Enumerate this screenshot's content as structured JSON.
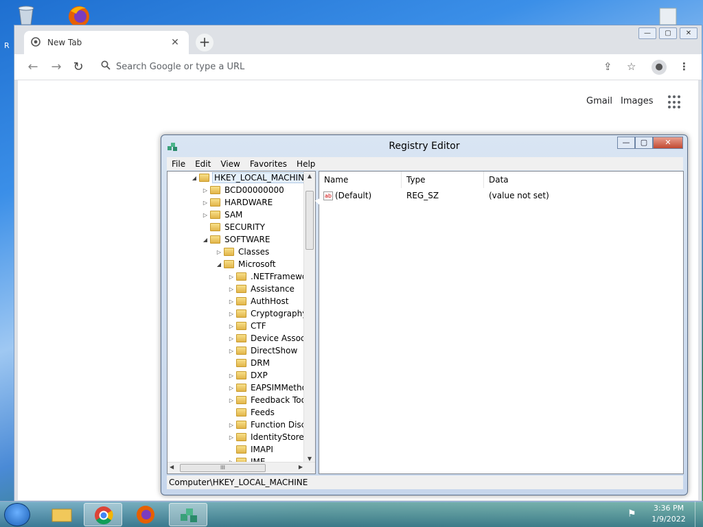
{
  "desktop": {
    "recycle_partial_label": "R"
  },
  "chrome": {
    "tab_title": "New Tab",
    "tab_close": "✕",
    "new_tab": "+",
    "omnibox_placeholder": "Search Google or type a URL",
    "links": {
      "gmail": "Gmail",
      "images": "Images"
    }
  },
  "registry": {
    "title": "Registry Editor",
    "menu": [
      "File",
      "Edit",
      "View",
      "Favorites",
      "Help"
    ],
    "tree": [
      {
        "label": "HKEY_LOCAL_MACHINE",
        "arrow": "◢",
        "selected": true,
        "level": 0
      },
      {
        "label": "BCD00000000",
        "arrow": "▷",
        "level": 1
      },
      {
        "label": "HARDWARE",
        "arrow": "▷",
        "level": 1
      },
      {
        "label": "SAM",
        "arrow": "▷",
        "level": 1
      },
      {
        "label": "SECURITY",
        "arrow": "",
        "level": 1
      },
      {
        "label": "SOFTWARE",
        "arrow": "◢",
        "level": 1
      },
      {
        "label": "Classes",
        "arrow": "▷",
        "level": 2
      },
      {
        "label": "Microsoft",
        "arrow": "◢",
        "level": 2
      },
      {
        "label": ".NETFramewor",
        "arrow": "▷",
        "level": 3
      },
      {
        "label": "Assistance",
        "arrow": "▷",
        "level": 3
      },
      {
        "label": "AuthHost",
        "arrow": "▷",
        "level": 3
      },
      {
        "label": "Cryptography",
        "arrow": "▷",
        "level": 3
      },
      {
        "label": "CTF",
        "arrow": "▷",
        "level": 3
      },
      {
        "label": "Device Associa",
        "arrow": "▷",
        "level": 3
      },
      {
        "label": "DirectShow",
        "arrow": "▷",
        "level": 3
      },
      {
        "label": "DRM",
        "arrow": "",
        "level": 3
      },
      {
        "label": "DXP",
        "arrow": "▷",
        "level": 3
      },
      {
        "label": "EAPSIMMetho",
        "arrow": "▷",
        "level": 3
      },
      {
        "label": "Feedback Tool",
        "arrow": "▷",
        "level": 3
      },
      {
        "label": "Feeds",
        "arrow": "",
        "level": 3
      },
      {
        "label": "Function Disco",
        "arrow": "▷",
        "level": 3
      },
      {
        "label": "IdentityStore",
        "arrow": "▷",
        "level": 3
      },
      {
        "label": "IMAPI",
        "arrow": "",
        "level": 3
      },
      {
        "label": "IME",
        "arrow": "▷",
        "level": 3
      }
    ],
    "columns": {
      "name": "Name",
      "type": "Type",
      "data": "Data"
    },
    "values": [
      {
        "name": "(Default)",
        "type": "REG_SZ",
        "data": "(value not set)",
        "icon": "ab"
      }
    ],
    "hscroll_grip": "III",
    "status": "Computer\\HKEY_LOCAL_MACHINE"
  },
  "taskbar": {
    "time": "3:36 PM",
    "date": "1/9/2022"
  }
}
